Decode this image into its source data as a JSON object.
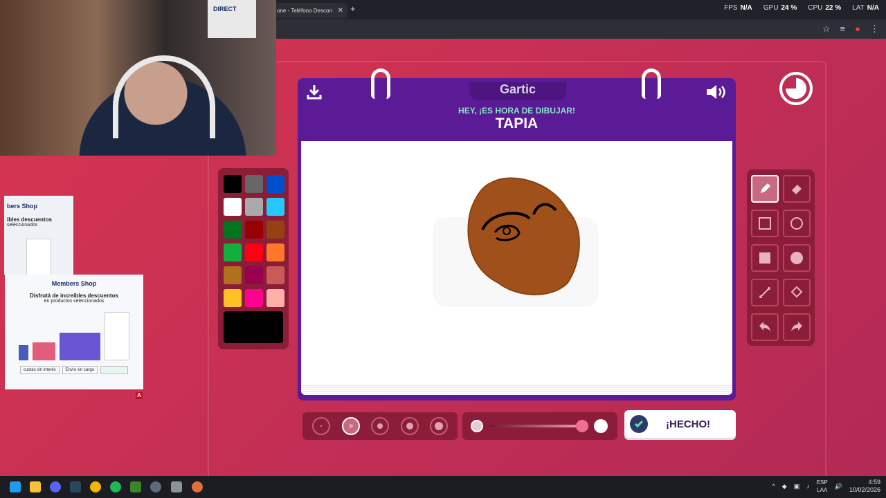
{
  "browser": {
    "tab_title": "one - Teléfono Descon",
    "tab_close": "✕",
    "new_tab": "+",
    "perf": [
      {
        "label": "FPS",
        "value": "N/A"
      },
      {
        "label": "GPU",
        "value": "24 %"
      },
      {
        "label": "CPU",
        "value": "22 %"
      },
      {
        "label": "LAT",
        "value": "N/A"
      }
    ]
  },
  "webcam": {
    "jersey_text": "DIRECT"
  },
  "ad": {
    "brand_partial": "bers Shop",
    "line1": "ibles descuentos",
    "line2": "seleccionados",
    "brand": "Members Shop",
    "headline": "Disfrutá de increíbles descuentos",
    "subline": "en productos seleccionados",
    "opt1": "cuotas sin interés",
    "opt2": "Envío sin cargo",
    "badge": "A"
  },
  "game": {
    "logo": "Gartic",
    "prompt": "HEY, ¡ES HORA DE DIBUJAR!",
    "word": "TAPIA",
    "done_label": "¡HECHO!"
  },
  "palette": {
    "colors": [
      "#000000",
      "#666666",
      "#0050cd",
      "#ffffff",
      "#aaaaaa",
      "#26c9ff",
      "#017420",
      "#990000",
      "#964112",
      "#11b03c",
      "#ff0013",
      "#ff7829",
      "#b0701c",
      "#99004e",
      "#cb5a57",
      "#ffc126",
      "#ff008f",
      "#feafa8"
    ],
    "selected": "#000000"
  },
  "tools": {
    "items": [
      "pencil",
      "eraser",
      "rectangle-outline",
      "circle-outline",
      "rectangle-fill",
      "circle-fill",
      "line",
      "fill-bucket",
      "undo",
      "redo"
    ],
    "active": "pencil"
  },
  "brush": {
    "sizes": 5,
    "selected_index": 1,
    "opacity_percent": 92
  },
  "taskbar": {
    "lang": "ESP",
    "lang2": "LAA",
    "time": "4:59",
    "date": "10/02/2026"
  }
}
